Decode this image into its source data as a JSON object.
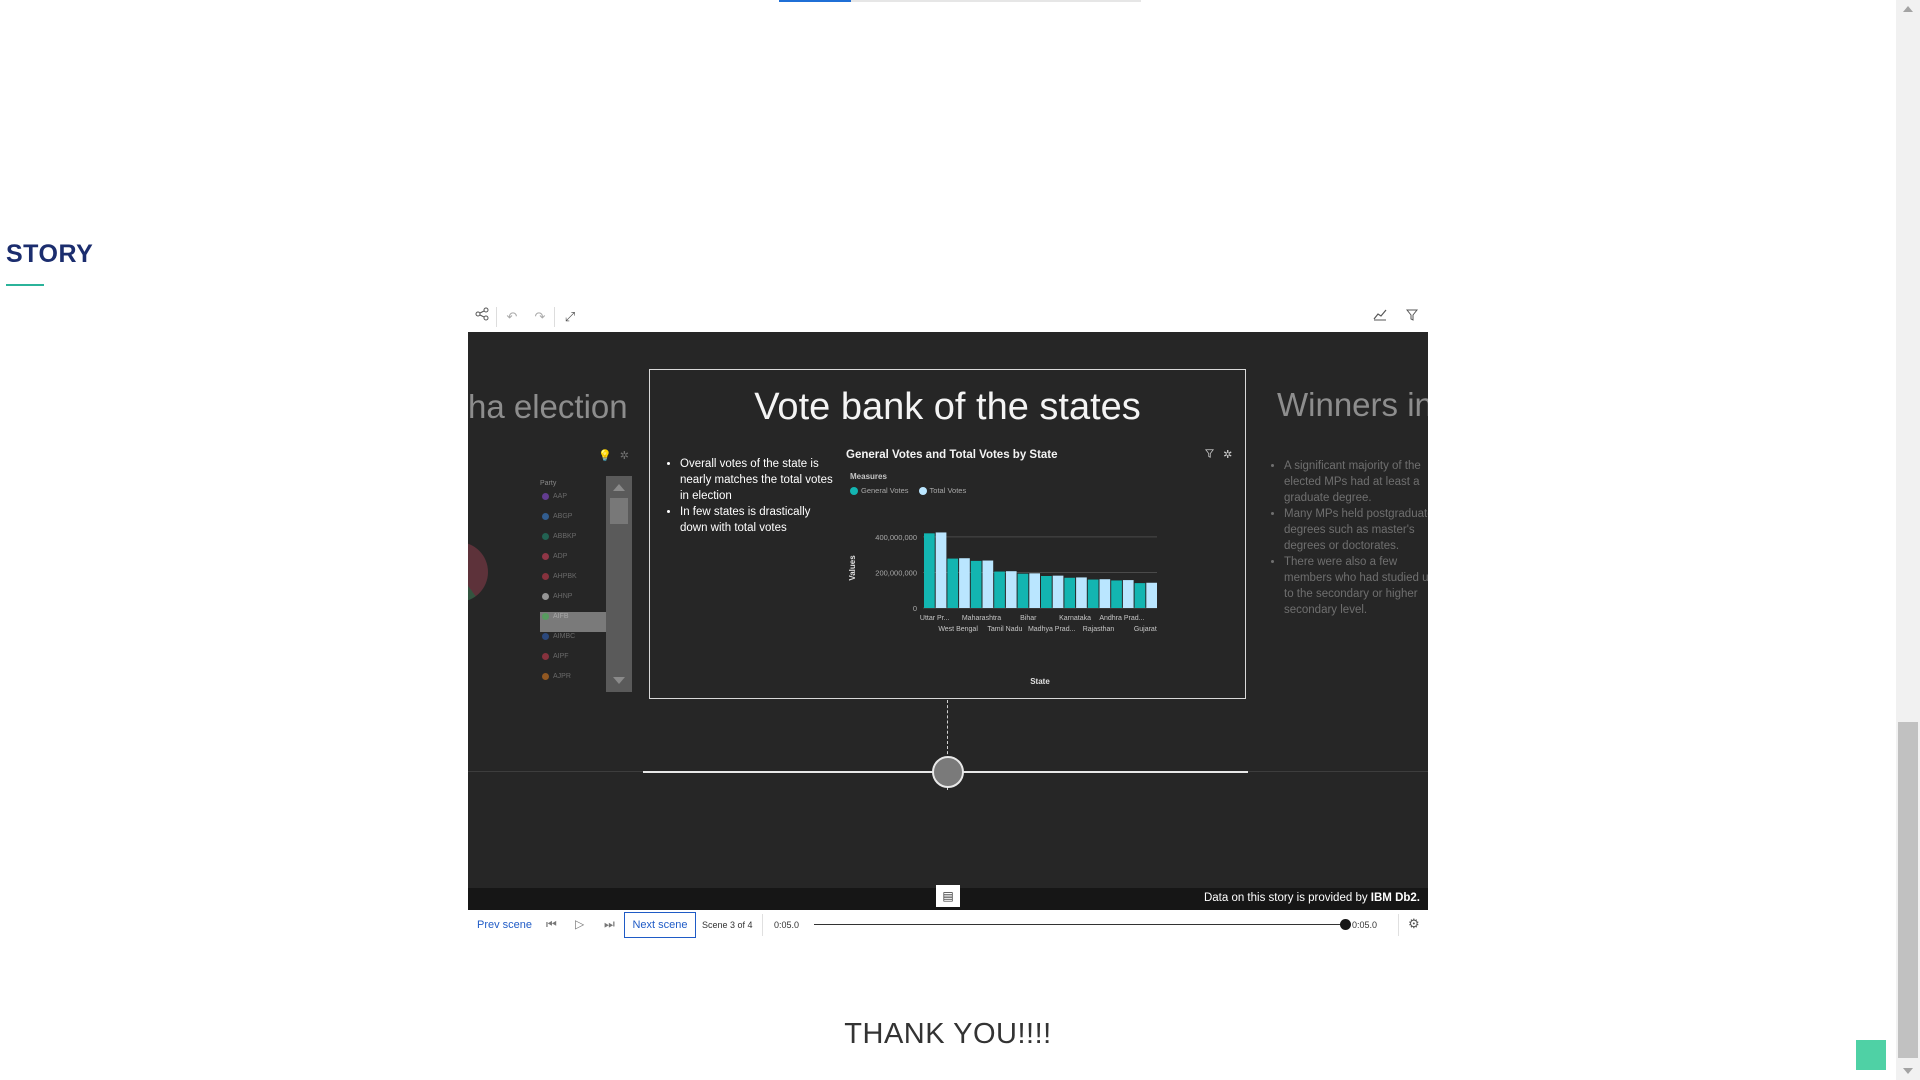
{
  "page": {
    "section_title": "STORY",
    "thank_you": "THANK YOU!!!!",
    "accent_color": "#2bb39a",
    "heading_color": "#1b2d6e"
  },
  "toolbar": {
    "left_icons": [
      "share-icon",
      "undo-icon",
      "redo-icon",
      "expand-icon"
    ],
    "right_icons": [
      "chart-icon",
      "filter-icon"
    ]
  },
  "scenes": {
    "prev_title": "ha election",
    "prev_legend_title": "Party",
    "prev_legend_items": [
      {
        "label": "AAP",
        "color": "#8a4bd6"
      },
      {
        "label": "ABGP",
        "color": "#3b82d6"
      },
      {
        "label": "ABBKP",
        "color": "#1f8a6f"
      },
      {
        "label": "ADP",
        "color": "#d6415c"
      },
      {
        "label": "AHPBK",
        "color": "#c73a4d"
      },
      {
        "label": "AHNP",
        "color": "#e0e0e0"
      },
      {
        "label": "AIFB",
        "color": "#3fb04d"
      },
      {
        "label": "AIMBC",
        "color": "#2e5fb6"
      },
      {
        "label": "AIPF",
        "color": "#c73a4d"
      },
      {
        "label": "AJPR",
        "color": "#d97a1f"
      }
    ],
    "next_title": "Winners in",
    "next_bullets": [
      "A significant majority of the elected MPs had at least a graduate degree.",
      "Many MPs held postgraduate degrees such as master's degrees or doctorates.",
      "There were also a few members who had studied up to the secondary or higher secondary level."
    ]
  },
  "scene": {
    "title": "Vote bank of the states",
    "bullets": [
      "Overall votes of the state is nearly matches the total votes in election",
      "In few states is drastically down with total votes"
    ]
  },
  "chart_data": {
    "type": "bar",
    "title": "General Votes and Total Votes by State",
    "legend_title": "Measures",
    "xlabel": "State",
    "ylabel": "Values",
    "ylim": [
      0,
      450000000
    ],
    "yticks": [
      0,
      200000000,
      400000000
    ],
    "ytick_labels": [
      "0",
      "200,000,000",
      "400,000,000"
    ],
    "categories": [
      "Uttar Pr...",
      "West Bengal",
      "Maharashtra",
      "Tamil Nadu",
      "Bihar",
      "Madhya Prad...",
      "Karnataka",
      "Rajasthan",
      "Andhra Prad...",
      "Gujarat"
    ],
    "series": [
      {
        "name": "General Votes",
        "color": "#13b5b1",
        "values": [
          420000000,
          278000000,
          265000000,
          205000000,
          193000000,
          180000000,
          170000000,
          160000000,
          155000000,
          140000000
        ]
      },
      {
        "name": "Total Votes",
        "color": "#bae6ff",
        "values": [
          425000000,
          280000000,
          267000000,
          207000000,
          195000000,
          182000000,
          172000000,
          162000000,
          157000000,
          142000000
        ]
      }
    ]
  },
  "footer": {
    "credit_prefix": "Data on this story is provided by ",
    "credit_brand": "IBM Db2."
  },
  "player": {
    "prev_label": "Prev scene",
    "next_label": "Next scene",
    "scene_count": "Scene 3 of 4",
    "time_start": "0:05.0",
    "time_end": "0:05.0",
    "progress": 1.0
  }
}
